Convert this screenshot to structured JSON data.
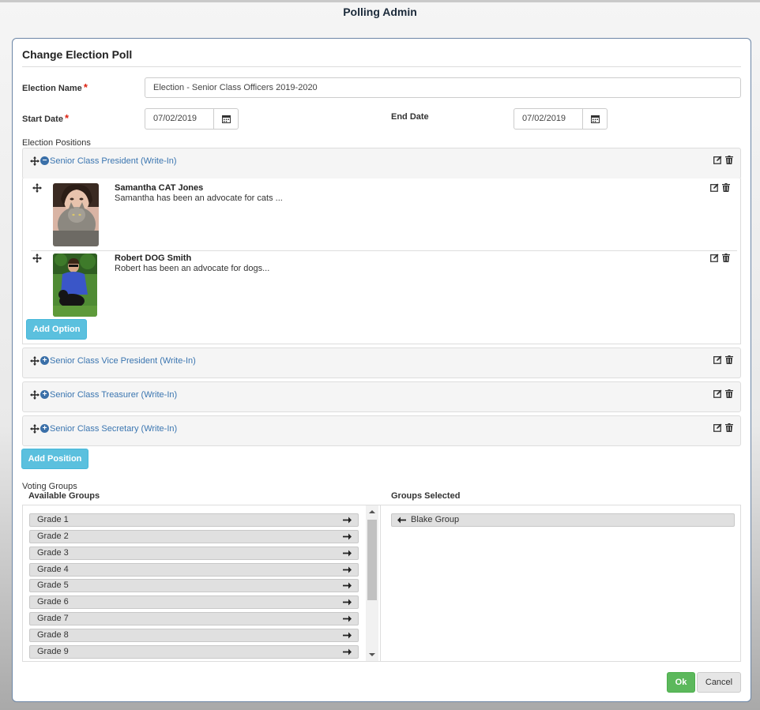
{
  "app": {
    "title": "Polling Admin"
  },
  "dialog": {
    "title": "Change Election Poll",
    "election_name_label": "Election Name",
    "election_name_value": "Election - Senior Class Officers 2019-2020",
    "start_date_label": "Start Date",
    "start_date_value": "07/02/2019",
    "end_date_label": "End Date",
    "end_date_value": "07/02/2019",
    "required_marker": "*",
    "positions_label": "Election Positions",
    "positions": [
      {
        "title": "Senior Class President (Write-In)",
        "expanded": true,
        "toggle_icon": "minus-circle-icon"
      },
      {
        "title": "Senior Class Vice President (Write-In)",
        "expanded": false,
        "toggle_icon": "plus-circle-icon"
      },
      {
        "title": "Senior Class Treasurer (Write-In)",
        "expanded": false,
        "toggle_icon": "plus-circle-icon"
      },
      {
        "title": "Senior Class Secretary (Write-In)",
        "expanded": false,
        "toggle_icon": "plus-circle-icon"
      }
    ],
    "options": [
      {
        "name": "Samantha CAT Jones",
        "description": "Samantha has been an advocate for cats ..."
      },
      {
        "name": "Robert DOG Smith",
        "description": "Robert has been an advocate for dogs..."
      }
    ],
    "add_option_label": "Add Option",
    "add_position_label": "Add Position",
    "voting_groups_label": "Voting Groups",
    "available_groups_label": "Available Groups",
    "groups_selected_label": "Groups Selected",
    "available_groups": [
      "Grade 1",
      "Grade 2",
      "Grade 3",
      "Grade 4",
      "Grade 5",
      "Grade 6",
      "Grade 7",
      "Grade 8",
      "Grade 9"
    ],
    "selected_groups": [
      "Blake Group"
    ],
    "ok_label": "Ok",
    "cancel_label": "Cancel"
  },
  "colors": {
    "link_blue": "#3a75b0",
    "info_button": "#5bc0de",
    "ok_button": "#5cb85c",
    "required": "#dd2211"
  }
}
